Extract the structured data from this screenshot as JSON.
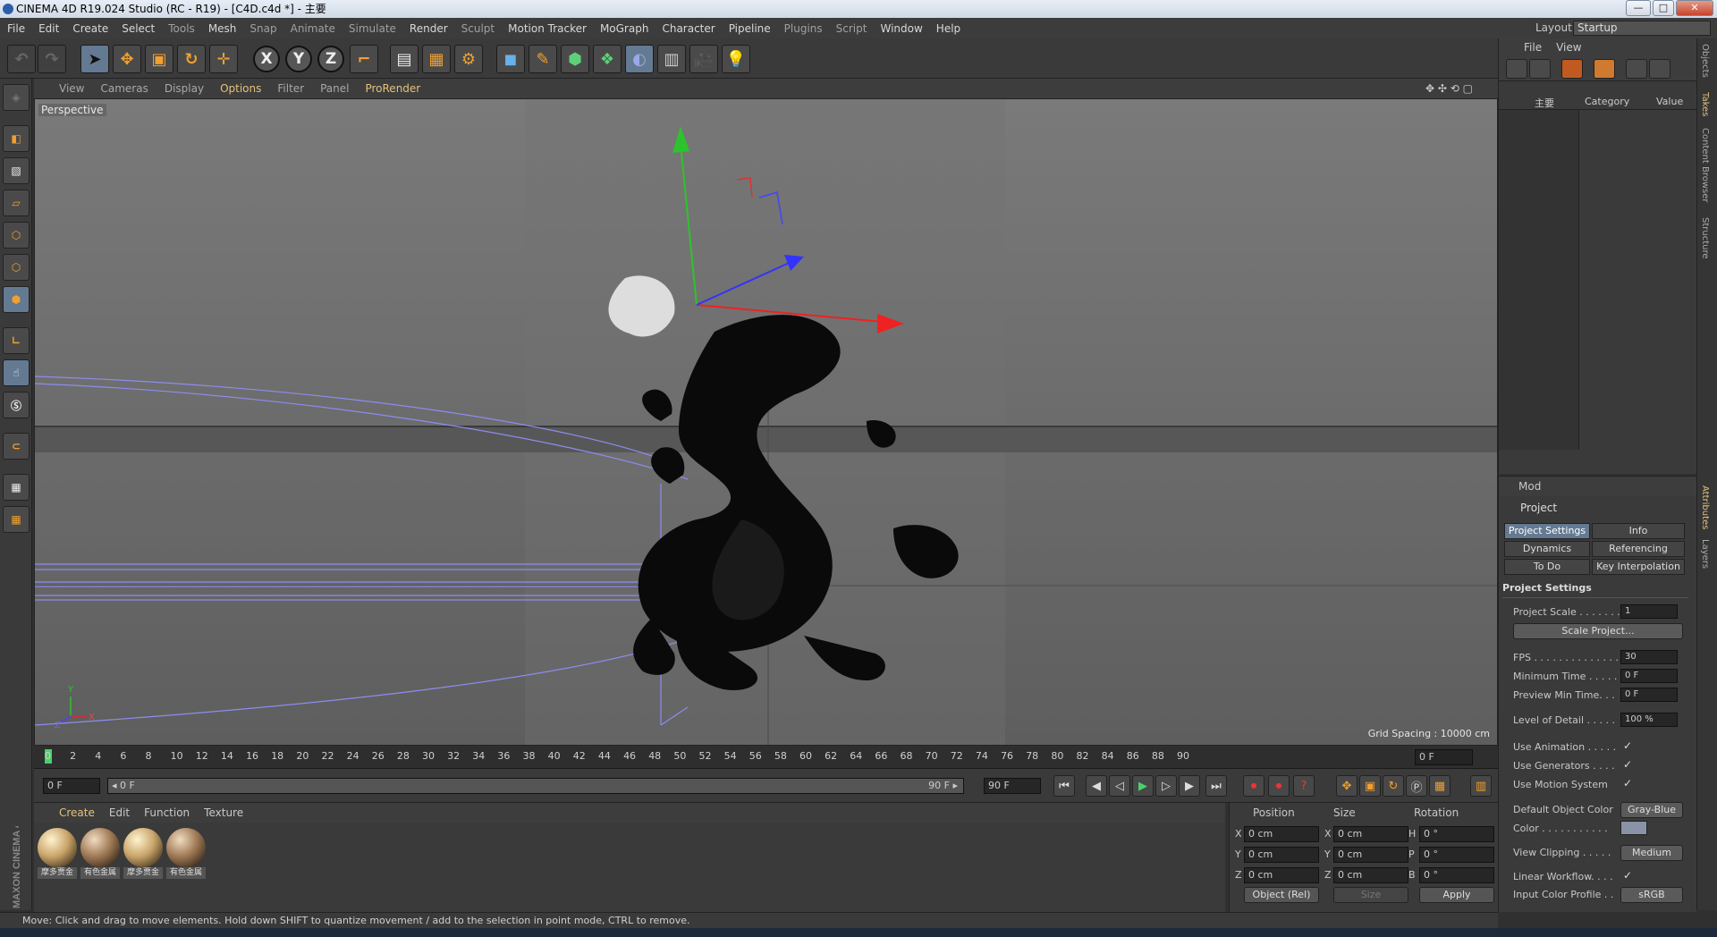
{
  "window": {
    "title": "CINEMA 4D R19.024 Studio (RC - R19) - [C4D.c4d *] - 主要",
    "controls": [
      "—",
      "□",
      "✕"
    ]
  },
  "menubar": {
    "items": [
      "File",
      "Edit",
      "Create",
      "Select",
      "Tools",
      "Mesh",
      "Snap",
      "Animate",
      "Simulate",
      "Render",
      "Sculpt",
      "Motion Tracker",
      "MoGraph",
      "Character",
      "Pipeline",
      "Plugins",
      "Script",
      "Window",
      "Help"
    ],
    "layout_label": "Layout:",
    "layout_value": "Startup"
  },
  "toolbar": {
    "axis_x": "X",
    "axis_y": "Y",
    "axis_z": "Z"
  },
  "viewport": {
    "menu": [
      "View",
      "Cameras",
      "Display",
      "Options",
      "Filter",
      "Panel",
      "ProRender"
    ],
    "label": "Perspective",
    "grid_spacing": "Grid Spacing : 10000 cm",
    "axis_y": "Y",
    "axis_z": "Z",
    "axis_x": "X"
  },
  "timeline": {
    "ticks": [
      "0",
      "2",
      "4",
      "6",
      "8",
      "10",
      "12",
      "14",
      "16",
      "18",
      "20",
      "22",
      "24",
      "26",
      "28",
      "30",
      "32",
      "34",
      "36",
      "38",
      "40",
      "42",
      "44",
      "46",
      "48",
      "50",
      "52",
      "54",
      "56",
      "58",
      "60",
      "62",
      "64",
      "66",
      "68",
      "70",
      "72",
      "74",
      "76",
      "78",
      "80",
      "82",
      "84",
      "86",
      "88",
      "90"
    ],
    "current_frame": "0 F"
  },
  "transport": {
    "start_field": "0 F",
    "range_start": "◂ 0 F",
    "range_end": "90 F ▸",
    "end_field": "90 F"
  },
  "material_manager": {
    "menu": [
      "Create",
      "Edit",
      "Function",
      "Texture"
    ],
    "materials": [
      {
        "name": "摩多贾金",
        "color": "#c9a56a"
      },
      {
        "name": "有色金属",
        "color": "#a07a56"
      },
      {
        "name": "摩多贾金",
        "color": "#c9a56a"
      },
      {
        "name": "有色金属",
        "color": "#a07a56"
      }
    ]
  },
  "coordinates": {
    "headers": [
      "Position",
      "Size",
      "Rotation"
    ],
    "rows": [
      {
        "p_label": "X",
        "p_val": "0 cm",
        "s_label": "X",
        "s_val": "0 cm",
        "r_label": "H",
        "r_val": "0 °"
      },
      {
        "p_label": "Y",
        "p_val": "0 cm",
        "s_label": "Y",
        "s_val": "0 cm",
        "r_label": "P",
        "r_val": "0 °"
      },
      {
        "p_label": "Z",
        "p_val": "0 cm",
        "s_label": "Z",
        "s_val": "0 cm",
        "r_label": "B",
        "r_val": "0 °"
      }
    ],
    "mode_select": "Object (Rel)",
    "size_select": "Size",
    "apply": "Apply"
  },
  "status": "Move: Click and drag to move elements. Hold down SHIFT to quantize movement / add to the selection in point mode, CTRL to remove.",
  "objects_panel": {
    "menu": [
      "File",
      "View"
    ],
    "root": "主要",
    "col_category": "Category",
    "col_value": "Value"
  },
  "side_tabs": [
    "Objects",
    "Takes",
    "Content Browser",
    "Structure"
  ],
  "side_tabs_lower": [
    "Attributes",
    "Layers"
  ],
  "attributes": {
    "mode": "Mod",
    "object": "Project",
    "tabs": [
      "Project Settings",
      "Info",
      "Dynamics",
      "Referencing",
      "To Do",
      "Key Interpolation"
    ],
    "section": "Project Settings",
    "project_scale_label": "Project Scale . . . . . . .",
    "project_scale_value": "1",
    "scale_project_btn": "Scale Project...",
    "fps_label": "FPS . . . . . . . . . . . . . . .",
    "fps_value": "30",
    "min_time_label": "Minimum Time . . . . .",
    "min_time_value": "0 F",
    "preview_min_label": "Preview Min Time. . .",
    "preview_min_value": "0 F",
    "lod_label": "Level of Detail . . . . .",
    "lod_value": "100 %",
    "use_animation": "Use Animation . . . . .",
    "use_generators": "Use Generators . . . .",
    "use_motion": "Use Motion System",
    "checkmark": "✓",
    "default_color_label": "Default Object Color",
    "default_color_value": "Gray-Blue",
    "color_label": "Color . . . . . . . . . . .",
    "view_clipping_label": "View Clipping . . . . .",
    "view_clipping_value": "Medium",
    "linear_workflow": "Linear Workflow. . . .",
    "input_color_label": "Input Color Profile . .",
    "input_color_value": "sRGB"
  }
}
